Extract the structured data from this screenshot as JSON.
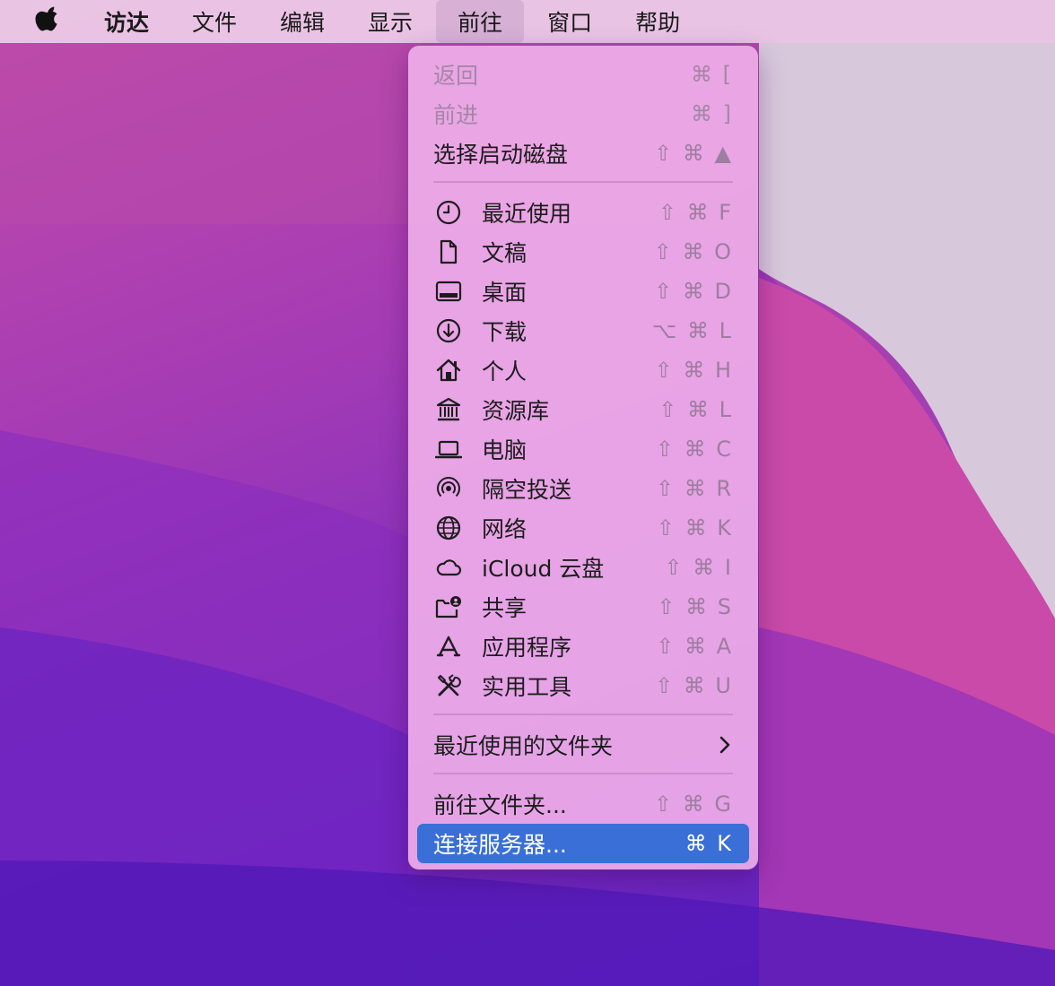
{
  "menubar": {
    "app_name": "访达",
    "items": [
      "文件",
      "编辑",
      "显示",
      "前往",
      "窗口",
      "帮助"
    ],
    "active_item": "前往"
  },
  "go_menu": {
    "nav": [
      {
        "label": "返回",
        "shortcut": "⌘ [",
        "enabled": false
      },
      {
        "label": "前进",
        "shortcut": "⌘ ]",
        "enabled": false
      },
      {
        "label": "选择启动磁盘",
        "shortcut": "⇧ ⌘ ▲",
        "enabled": true
      }
    ],
    "places": [
      {
        "label": "最近使用",
        "shortcut": "⇧ ⌘ F",
        "icon": "clock-icon"
      },
      {
        "label": "文稿",
        "shortcut": "⇧ ⌘ O",
        "icon": "document-icon"
      },
      {
        "label": "桌面",
        "shortcut": "⇧ ⌘ D",
        "icon": "desktop-icon"
      },
      {
        "label": "下载",
        "shortcut": "⌥ ⌘ L",
        "icon": "download-icon"
      },
      {
        "label": "个人",
        "shortcut": "⇧ ⌘ H",
        "icon": "home-icon"
      },
      {
        "label": "资源库",
        "shortcut": "⇧ ⌘ L",
        "icon": "library-icon"
      },
      {
        "label": "电脑",
        "shortcut": "⇧ ⌘ C",
        "icon": "laptop-icon"
      },
      {
        "label": "隔空投送",
        "shortcut": "⇧ ⌘ R",
        "icon": "airdrop-icon"
      },
      {
        "label": "网络",
        "shortcut": "⇧ ⌘ K",
        "icon": "globe-icon"
      },
      {
        "label": "iCloud 云盘",
        "shortcut": "⇧ ⌘ I",
        "icon": "cloud-icon"
      },
      {
        "label": "共享",
        "shortcut": "⇧ ⌘ S",
        "icon": "shared-folder-icon"
      },
      {
        "label": "应用程序",
        "shortcut": "⇧ ⌘ A",
        "icon": "applications-icon"
      },
      {
        "label": "实用工具",
        "shortcut": "⇧ ⌘ U",
        "icon": "utilities-icon"
      }
    ],
    "recent_folders": {
      "label": "最近使用的文件夹"
    },
    "go_to_folder": {
      "label": "前往文件夹...",
      "shortcut": "⇧ ⌘ G"
    },
    "connect_server": {
      "label": "连接服务器...",
      "shortcut": "⌘ K",
      "highlighted": true
    }
  },
  "colors": {
    "highlight": "#3a6fd8",
    "menu_background": "#eeace8",
    "disabled_text": "#a387a6"
  }
}
